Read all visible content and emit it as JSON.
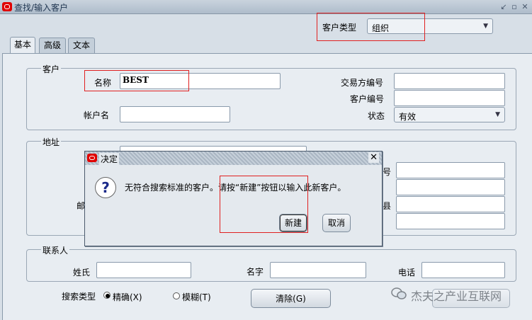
{
  "window": {
    "title": "查找/输入客户",
    "min_glyph": "↙",
    "restore_glyph": "▫",
    "close_glyph": "✕"
  },
  "customer_type": {
    "label": "客户类型",
    "value": "组织"
  },
  "tabs": [
    {
      "label": "基本"
    },
    {
      "label": "高级"
    },
    {
      "label": "文本"
    }
  ],
  "customer_group": {
    "legend": "客户",
    "name_label": "名称",
    "name_value": "BEST",
    "account_label": "帐户名",
    "account_value": "",
    "trading_partner_label": "交易方编号",
    "customer_number_label": "客户编号",
    "status_label": "状态",
    "status_value": "有效"
  },
  "address_group": {
    "legend": "地址",
    "partial_right_label_1": "号",
    "partial_left_label": "邮",
    "partial_right_label_3": "县"
  },
  "contact_group": {
    "legend": "联系人",
    "last_name_label": "姓氏",
    "first_name_label": "名字",
    "phone_label": "电话"
  },
  "search": {
    "type_label": "搜索类型",
    "exact_label": "精确(X)",
    "fuzzy_label": "模糊(T)",
    "clear_label": "清除(G)"
  },
  "dialog": {
    "title": "决定",
    "close_glyph": "✕",
    "message": "无符合搜索标准的客户。请按“新建”按钮以输入此新客户。",
    "new_label": "新建",
    "cancel_label": "取消",
    "icon": "?"
  },
  "watermark": {
    "text": "杰夫之产业互联网"
  }
}
